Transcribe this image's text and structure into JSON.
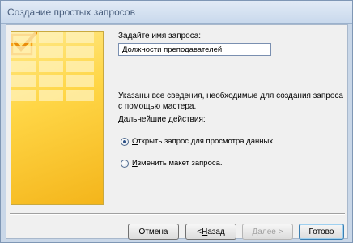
{
  "window": {
    "title": "Создание простых запросов"
  },
  "form": {
    "name_label": "Задайте имя запроса:",
    "name_value": "Должности преподавателей",
    "info_text": "Указаны все сведения, необходимые для создания запроса с помощью мастера.",
    "next_actions_label": "Дальнейшие действия:"
  },
  "options": [
    {
      "accel": "О",
      "rest": "ткрыть запрос для просмотра данных.",
      "checked": true
    },
    {
      "accel": "И",
      "rest": "зменить макет запроса.",
      "checked": false
    }
  ],
  "buttons": {
    "cancel": "Отмена",
    "back_prefix": "< ",
    "back_accel": "Н",
    "back_rest": "азад",
    "next": "Далее >",
    "finish": "Готово"
  },
  "colors": {
    "panel_yellow": "#ffd646",
    "panel_orange": "#f4b51b",
    "window_frame": "#c9d7e8"
  }
}
